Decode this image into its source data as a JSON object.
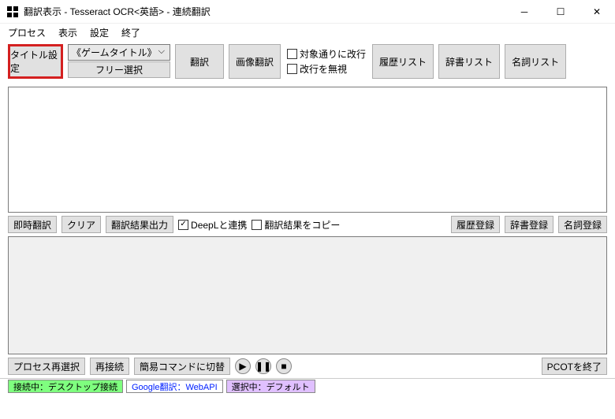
{
  "window": {
    "title": "翻訳表示 - Tesseract OCR<英語> - 連続翻訳"
  },
  "menu": {
    "process": "プロセス",
    "view": "表示",
    "settings": "設定",
    "exit": "終了"
  },
  "toolbar": {
    "title_set": "タイトル設定",
    "combo_label": "《ゲームタイトル》",
    "free_select": "フリー選択",
    "translate": "翻訳",
    "image_translate": "画像翻訳",
    "chk_break_target": "対象通りに改行",
    "chk_ignore_break": "改行を無視",
    "history_list": "履歴リスト",
    "dict_list": "辞書リスト",
    "noun_list": "名詞リスト"
  },
  "mid": {
    "immediate": "即時翻訳",
    "clear": "クリア",
    "output": "翻訳結果出力",
    "deepl": "DeepLと連携",
    "deepl_checked": "✓",
    "copy_result": "翻訳結果をコピー",
    "hist_reg": "履歴登録",
    "dict_reg": "辞書登録",
    "noun_reg": "名詞登録"
  },
  "bottom": {
    "reselect": "プロセス再選択",
    "reconnect": "再接続",
    "switch_cmd": "簡易コマンドに切替",
    "exit_pcot": "PCOTを終了"
  },
  "status": {
    "conn": "接続中：デスクトップ接続",
    "api": "Google翻訳：WebAPI",
    "sel": "選択中：デフォルト"
  }
}
